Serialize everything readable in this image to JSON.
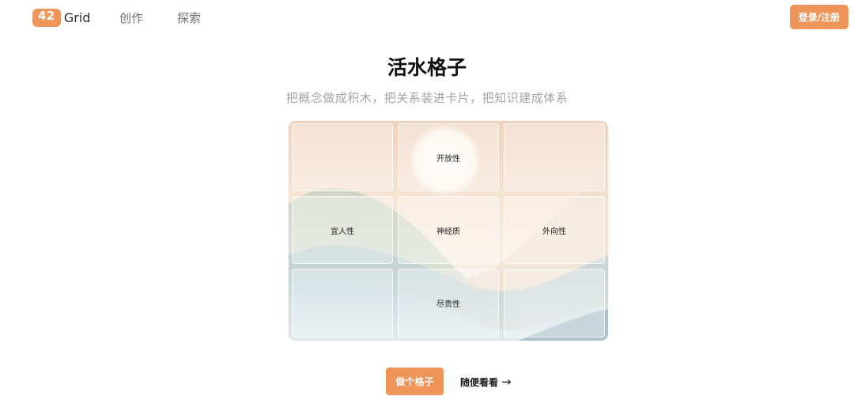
{
  "nav": {
    "logo_number": "42",
    "logo_text": "Grid",
    "links": [
      "创作",
      "探索"
    ],
    "login_label": "登录/注册"
  },
  "hero": {
    "title": "活水格子",
    "subtitle": "把概念做成积木，把关系装进卡片，把知识建成体系"
  },
  "grid": {
    "cells": [
      [
        "",
        "开放性",
        ""
      ],
      [
        "宜人性",
        "神经质",
        "外向性"
      ],
      [
        "",
        "尽责性",
        ""
      ]
    ]
  },
  "actions": {
    "primary_label": "做个格子",
    "secondary_label": "随便看看",
    "arrow": "→"
  },
  "colors": {
    "accent": "#f0955a",
    "title": "#111111",
    "subtitle": "#a3a3a3"
  }
}
